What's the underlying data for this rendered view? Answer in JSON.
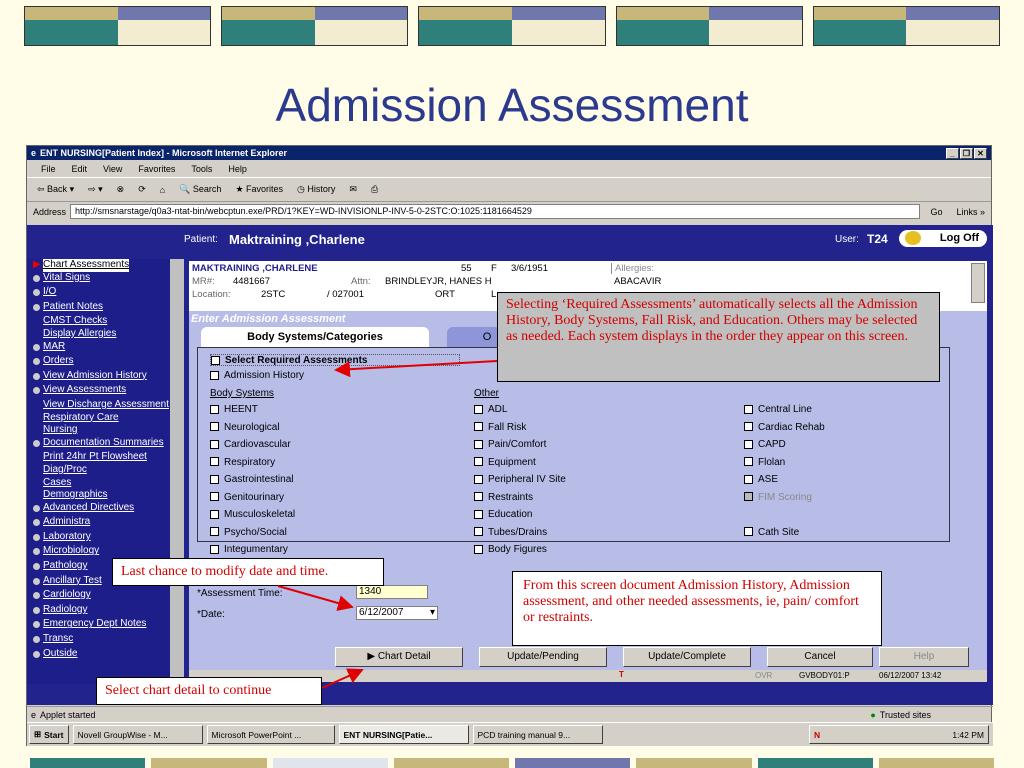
{
  "slide": {
    "title": "Admission Assessment"
  },
  "window": {
    "title": "ENT NURSING[Patient Index] - Microsoft Internet Explorer",
    "menu": [
      "File",
      "Edit",
      "View",
      "Favorites",
      "Tools",
      "Help"
    ],
    "toolbar": {
      "back": "Back",
      "search": "Search",
      "favorites": "Favorites",
      "history": "History"
    },
    "address_label": "Address",
    "url": "http://smsnarstage/q0a3-ntat-bin/webcptun.exe/PRD/1?KEY=WD-INVISIONLP-INV-5-0-2STC:O:1025:1181664529",
    "go": "Go",
    "links": "Links »"
  },
  "header": {
    "patient_label": "Patient:",
    "patient_name": "Maktraining ,Charlene",
    "user_label": "User:",
    "user": "T24",
    "logoff": "Log Off"
  },
  "sidebar": [
    {
      "label": "Chart Assessments",
      "kind": "arrow"
    },
    {
      "label": "Vital Signs",
      "kind": "dot"
    },
    {
      "label": "I/O",
      "kind": "dot"
    },
    {
      "label": "Patient Notes",
      "kind": "dot"
    },
    {
      "label": "CMST Checks",
      "kind": "none"
    },
    {
      "label": "Display Allergies",
      "kind": "none"
    },
    {
      "label": "MAR",
      "kind": "dot"
    },
    {
      "label": "Orders",
      "kind": "dot"
    },
    {
      "label": "View Admission History",
      "kind": "dot"
    },
    {
      "label": "View Assessments",
      "kind": "dot"
    },
    {
      "label": "View Discharge Assessment",
      "kind": "none"
    },
    {
      "label": "Respiratory Care",
      "kind": "none"
    },
    {
      "label": "Nursing",
      "kind": "none"
    },
    {
      "label": "Documentation Summaries",
      "kind": "dot"
    },
    {
      "label": "Print 24hr Pt Flowsheet",
      "kind": "none"
    },
    {
      "label": "Diag/Proc",
      "kind": "none"
    },
    {
      "label": "Cases",
      "kind": "none"
    },
    {
      "label": "Demographics",
      "kind": "none"
    },
    {
      "label": "Advanced Directives",
      "kind": "dot"
    },
    {
      "label": "Administra",
      "kind": "dot"
    },
    {
      "label": "Laboratory",
      "kind": "dot"
    },
    {
      "label": "Microbiology",
      "kind": "dot"
    },
    {
      "label": "Pathology",
      "kind": "dot"
    },
    {
      "label": "Ancillary Test",
      "kind": "dot"
    },
    {
      "label": "Cardiology",
      "kind": "dot"
    },
    {
      "label": "Radiology",
      "kind": "dot"
    },
    {
      "label": "Emergency Dept Notes",
      "kind": "dot"
    },
    {
      "label": "Transc",
      "kind": "dot"
    },
    {
      "label": "Outside",
      "kind": "dot"
    }
  ],
  "patient": {
    "name": "MAKTRAINING ,CHARLENE",
    "age": "55",
    "sex": "F",
    "dob": "3/6/1951",
    "mr_label": "MR#:",
    "mr": "4481667",
    "attn_label": "Attn:",
    "attn": "BRINDLEYJR, HANES H",
    "loc_label": "Location:",
    "loc": "2STC",
    "bed": "/ 027001",
    "service": "ORT",
    "extra": "L",
    "allergies_label": "Allergies:",
    "allergy": "ABACAVIR"
  },
  "form": {
    "section_title": "Enter Admission Assessment",
    "tab": "Body Systems/Categories",
    "tab2": "O",
    "select_required": "Select Required Assessments",
    "admission_history": "Admission History",
    "col_body": "Body Systems",
    "col_other": "Other",
    "body_systems": [
      "HEENT",
      "Neurological",
      "Cardiovascular",
      "Respiratory",
      "Gastrointestinal",
      "Genitourinary",
      "Musculoskeletal",
      "Psycho/Social",
      "Integumentary"
    ],
    "other1": [
      "ADL",
      "Fall Risk",
      "Pain/Comfort",
      "Equipment",
      "Peripheral IV Site",
      "Restraints",
      "Education",
      "Tubes/Drains",
      "Body Figures"
    ],
    "other2": [
      "Central Line",
      "Cardiac Rehab",
      "CAPD",
      "Flolan",
      "ASE",
      "FIM Scoring",
      "",
      "Cath Site"
    ],
    "time_label": "*Assessment Time:",
    "time": "1340",
    "date_label": "*Date:",
    "date": "6/12/2007"
  },
  "buttons": [
    "Chart Detail",
    "Update/Pending",
    "Update/Complete",
    "Cancel",
    "Help"
  ],
  "statusbar": {
    "ovr": "OVR",
    "code": "GVBODY01:P",
    "datetime": "06/12/2007 13:42",
    "applet": "Applet started",
    "zone": "Trusted sites"
  },
  "taskbar": {
    "start": "Start",
    "tasks": [
      "Novell GroupWise - M...",
      "Microsoft PowerPoint ...",
      "ENT NURSING[Patie...",
      "PCD training manual 9..."
    ],
    "clock": "1:42 PM"
  },
  "callouts": {
    "required": "Selecting ‘Required Assessments’ automatically selects all the Admission History, Body Systems, Fall Risk, and Education. Others may be selected as needed. Each system displays in the order they appear on this screen.",
    "lastchance": "Last chance to modify date and time.",
    "fromscreen": "From this screen document Admission History, Admission assessment, and other needed assessments, ie, pain/ comfort or restraints.",
    "chartdetail": "Select chart detail to continue"
  },
  "colors": {
    "title": "#2b3a8e",
    "callout_text": "#d00000",
    "app_bg": "#23238e",
    "form_bg": "#b8bde8"
  }
}
